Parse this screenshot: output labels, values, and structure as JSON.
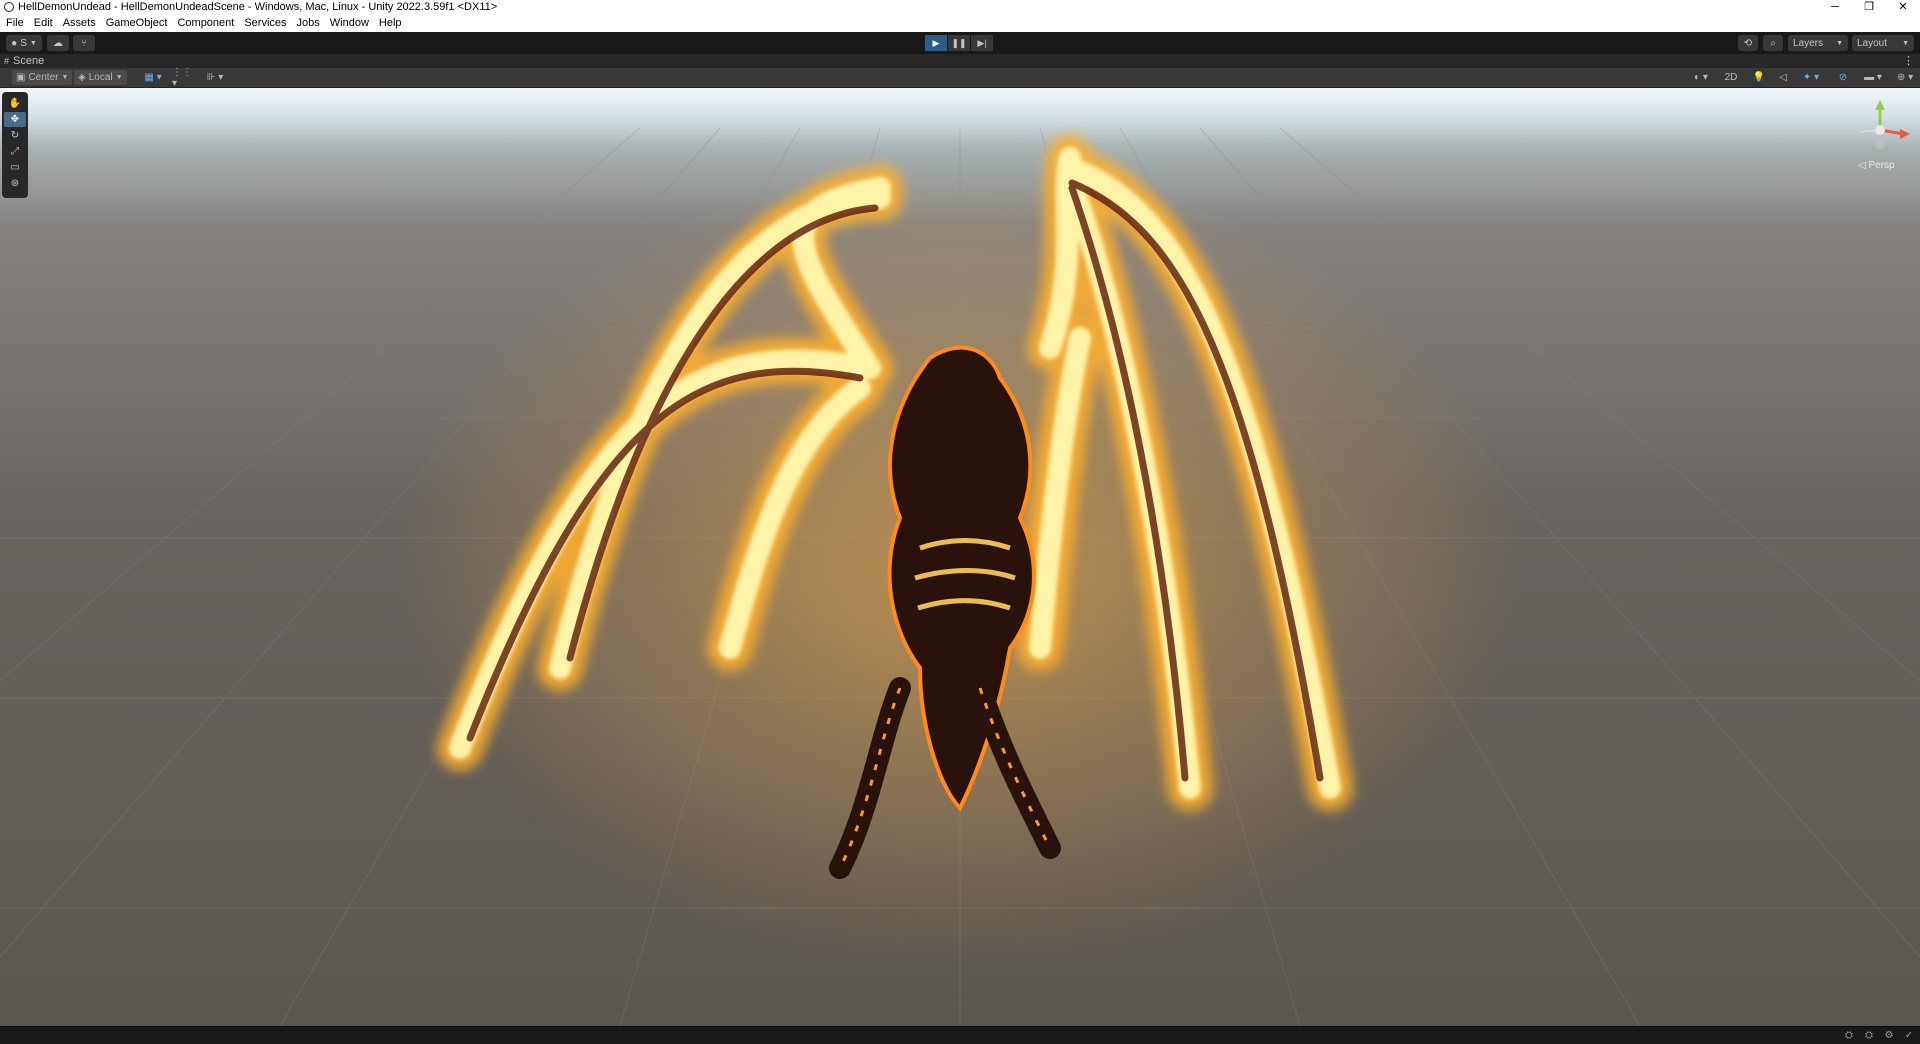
{
  "window": {
    "title": "HellDemonUndead - HellDemonUndeadScene - Windows, Mac, Linux - Unity 2022.3.59f1 <DX11>",
    "minimize": "─",
    "restore": "❐",
    "close": "✕"
  },
  "menu": [
    "File",
    "Edit",
    "Assets",
    "GameObject",
    "Component",
    "Services",
    "Jobs",
    "Window",
    "Help"
  ],
  "toolbar": {
    "account_label": "S",
    "layers_label": "Layers",
    "layout_label": "Layout"
  },
  "scene_tab": {
    "label": "Scene"
  },
  "scene_toolbar": {
    "pivot_label": "Center",
    "space_label": "Local",
    "mode_2d": "2D"
  },
  "gizmo": {
    "projection": "◁ Persp"
  },
  "colors": {
    "accent": "#2c5d87",
    "fire": "#ff9a1f",
    "editor_dark": "#191919"
  }
}
